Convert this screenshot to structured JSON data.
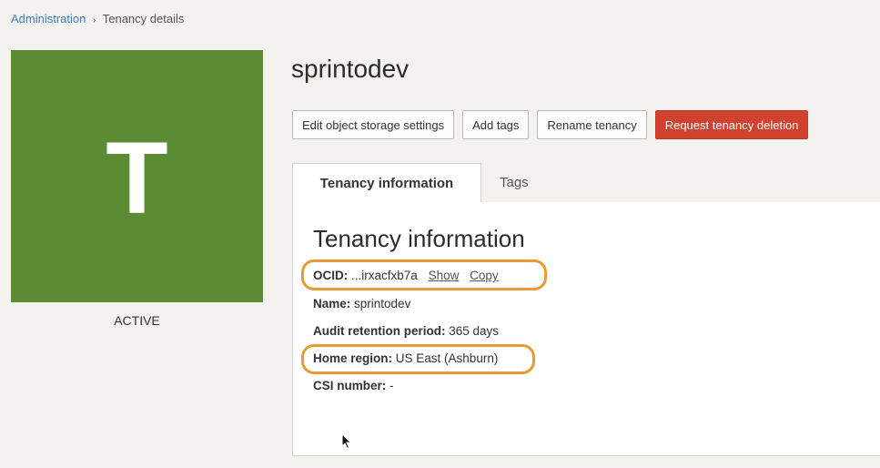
{
  "breadcrumb": {
    "parent": "Administration",
    "separator": "›",
    "current": "Tenancy details"
  },
  "avatar": {
    "letter": "T",
    "color": "#5b8c34",
    "status": "ACTIVE"
  },
  "title": "sprintodev",
  "actions": {
    "edit_storage": "Edit object storage settings",
    "add_tags": "Add tags",
    "rename": "Rename tenancy",
    "request_delete": "Request tenancy deletion"
  },
  "tabs": {
    "info": "Tenancy information",
    "tags": "Tags"
  },
  "info": {
    "heading": "Tenancy information",
    "ocid": {
      "label": "OCID:",
      "value": "...irxacfxb7a",
      "show": "Show",
      "copy": "Copy"
    },
    "name": {
      "label": "Name:",
      "value": "sprintodev"
    },
    "audit": {
      "label": "Audit retention period:",
      "value": "365 days"
    },
    "home": {
      "label": "Home region:",
      "value": "US East (Ashburn)"
    },
    "csi": {
      "label": "CSI number:",
      "value": "-"
    }
  },
  "colors": {
    "accent_link": "#3f7fc2",
    "danger": "#d0422f",
    "highlight": "#e99a34"
  }
}
